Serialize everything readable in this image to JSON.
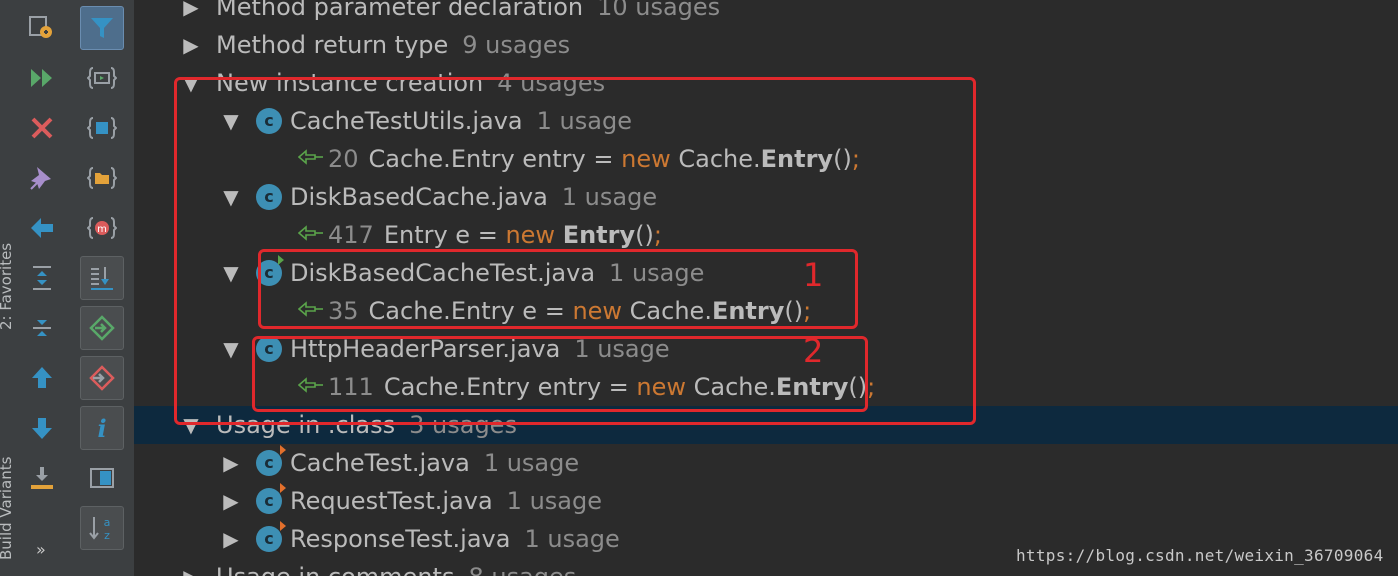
{
  "side_strip": {
    "labels": [
      "2: Favorites",
      "Build Variants"
    ]
  },
  "toolbar": {
    "more_label": "»"
  },
  "tree": {
    "rows": [
      {
        "kind": "group",
        "expanded": false,
        "label": "Method parameter declaration",
        "count": "10 usages"
      },
      {
        "kind": "group",
        "expanded": false,
        "label": "Method return type",
        "count": "9 usages"
      },
      {
        "kind": "group",
        "expanded": true,
        "label": "New instance creation",
        "count": "4 usages"
      },
      {
        "kind": "file",
        "expanded": true,
        "file": "CacheTestUtils.java",
        "count": "1 usage",
        "test": false
      },
      {
        "kind": "usage",
        "line": "20",
        "code": [
          [
            "t",
            "Cache.Entry entry = "
          ],
          [
            "k",
            "new"
          ],
          [
            "t",
            " Cache."
          ],
          [
            "b",
            "Entry"
          ],
          [
            "t",
            "()"
          ],
          [
            "p",
            ";"
          ]
        ]
      },
      {
        "kind": "file",
        "expanded": true,
        "file": "DiskBasedCache.java",
        "count": "1 usage",
        "test": false
      },
      {
        "kind": "usage",
        "line": "417",
        "code": [
          [
            "t",
            "Entry e = "
          ],
          [
            "k",
            "new"
          ],
          [
            "t",
            " "
          ],
          [
            "b",
            "Entry"
          ],
          [
            "t",
            "()"
          ],
          [
            "p",
            ";"
          ]
        ]
      },
      {
        "kind": "file",
        "expanded": true,
        "file": "DiskBasedCacheTest.java",
        "count": "1 usage",
        "test": true
      },
      {
        "kind": "usage",
        "line": "35",
        "code": [
          [
            "t",
            "Cache.Entry e = "
          ],
          [
            "k",
            "new"
          ],
          [
            "t",
            " Cache."
          ],
          [
            "b",
            "Entry"
          ],
          [
            "t",
            "()"
          ],
          [
            "p",
            ";"
          ]
        ]
      },
      {
        "kind": "file",
        "expanded": true,
        "file": "HttpHeaderParser.java",
        "count": "1 usage",
        "test": false
      },
      {
        "kind": "usage",
        "line": "111",
        "code": [
          [
            "t",
            "Cache.Entry entry = "
          ],
          [
            "k",
            "new"
          ],
          [
            "t",
            " Cache."
          ],
          [
            "b",
            "Entry"
          ],
          [
            "t",
            "()"
          ],
          [
            "p",
            ";"
          ]
        ]
      },
      {
        "kind": "group",
        "expanded": true,
        "label": "Usage in .class",
        "count": "3 usages",
        "selected": true
      },
      {
        "kind": "file",
        "expanded": false,
        "file": "CacheTest.java",
        "count": "1 usage",
        "test": true
      },
      {
        "kind": "file",
        "expanded": false,
        "file": "RequestTest.java",
        "count": "1 usage",
        "test": true
      },
      {
        "kind": "file",
        "expanded": false,
        "file": "ResponseTest.java",
        "count": "1 usage",
        "test": true
      },
      {
        "kind": "group",
        "expanded": false,
        "label": "Usage in comments",
        "count": "8 usages"
      }
    ]
  },
  "annotations": {
    "box1_label": "1",
    "box2_label": "2"
  },
  "watermark": "https://blog.csdn.net/weixin_36709064",
  "colors": {
    "accent_red": "#e0282c",
    "keyword": "#cc7832",
    "usage_green": "#5aa34a",
    "class_icon": "#3d8fb4",
    "selection": "#0d293e"
  }
}
